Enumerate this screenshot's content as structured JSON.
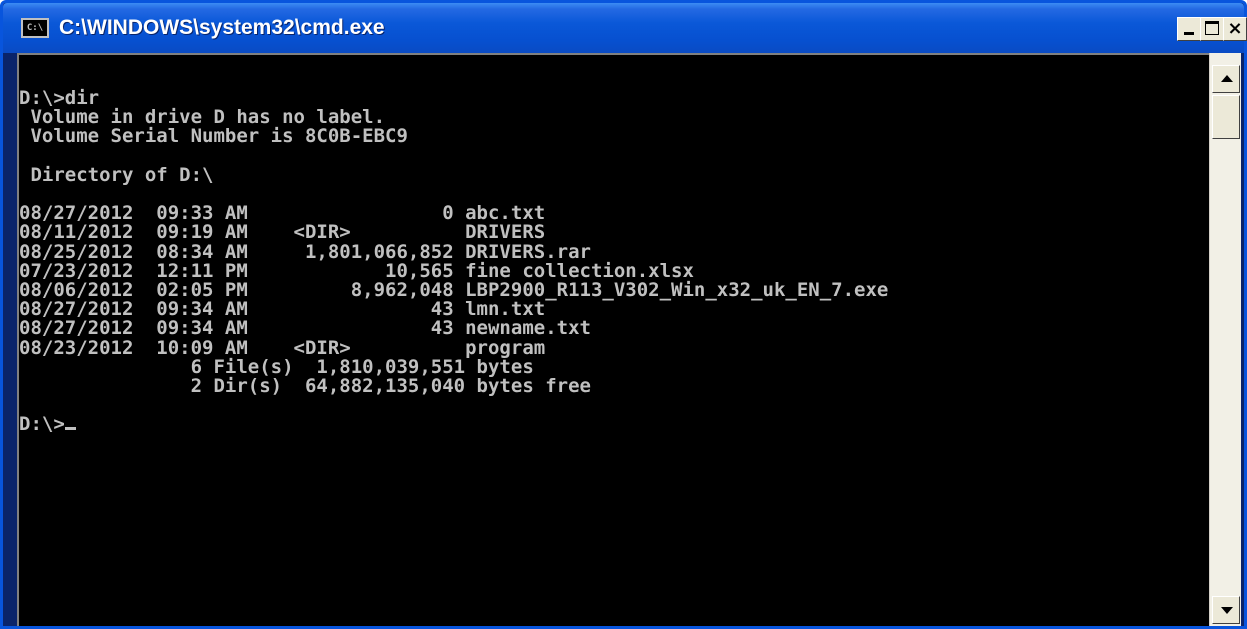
{
  "window": {
    "title": "C:\\WINDOWS\\system32\\cmd.exe",
    "icon_label": "C:\\",
    "icon": "console-icon",
    "controls": {
      "minimize_icon": "minimize-icon",
      "maximize_icon": "maximize-icon",
      "close_icon": "close-icon",
      "close_glyph": "×"
    }
  },
  "console": {
    "text_color": "#c0c0c0",
    "background": "#000000",
    "lines": [
      "D:\\>dir",
      " Volume in drive D has no label.",
      " Volume Serial Number is 8C0B-EBC9",
      "",
      " Directory of D:\\",
      "",
      "08/27/2012  09:33 AM                 0 abc.txt",
      "08/11/2012  09:19 AM    <DIR>          DRIVERS",
      "08/25/2012  08:34 AM     1,801,066,852 DRIVERS.rar",
      "07/23/2012  12:11 PM            10,565 fine collection.xlsx",
      "08/06/2012  02:05 PM         8,962,048 LBP2900_R113_V302_Win_x32_uk_EN_7.exe",
      "08/27/2012  09:34 AM                43 lmn.txt",
      "08/27/2012  09:34 AM                43 newname.txt",
      "08/23/2012  10:09 AM    <DIR>          program",
      "               6 File(s)  1,810,039,551 bytes",
      "               2 Dir(s)  64,882,135,040 bytes free",
      "",
      "D:\\>"
    ]
  },
  "scrollbar": {
    "up_icon": "scroll-up-arrow-icon",
    "down_icon": "scroll-down-arrow-icon"
  }
}
